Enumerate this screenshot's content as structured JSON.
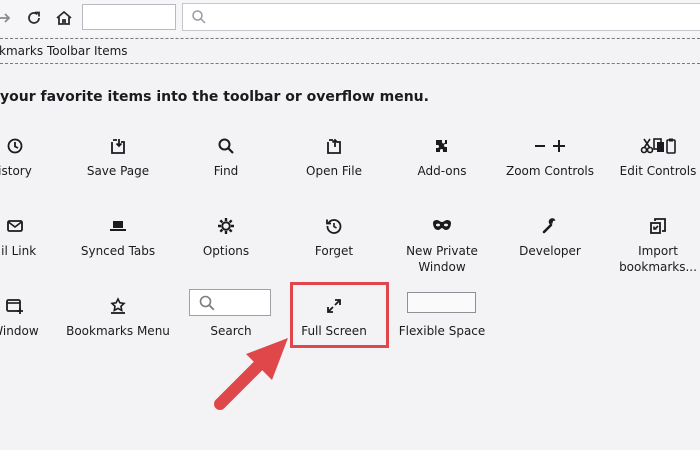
{
  "bookmarks_toolbar": {
    "label": "kmarks Toolbar Items"
  },
  "instruction": "your favorite items into the toolbar or overflow menu.",
  "rows": [
    [
      {
        "label": "istory",
        "icon": "history-icon"
      },
      {
        "label": "Save Page",
        "icon": "save-page-icon"
      },
      {
        "label": "Find",
        "icon": "search-icon"
      },
      {
        "label": "Open File",
        "icon": "open-file-icon"
      },
      {
        "label": "Add-ons",
        "icon": "puzzle-icon"
      },
      {
        "label": "Zoom Controls",
        "icon": "zoom-controls-icon"
      },
      {
        "label": "Edit Controls",
        "icon": "edit-controls-icon"
      }
    ],
    [
      {
        "label": "ail Link",
        "icon": "mail-icon"
      },
      {
        "label": "Synced Tabs",
        "icon": "synced-tabs-icon"
      },
      {
        "label": "Options",
        "icon": "gear-icon"
      },
      {
        "label": "Forget",
        "icon": "forget-icon"
      },
      {
        "label": "New Private Window",
        "icon": "private-mask-icon"
      },
      {
        "label": "Developer",
        "icon": "wrench-icon"
      },
      {
        "label": "Import bookmarks...",
        "icon": "import-icon"
      }
    ],
    [
      {
        "label": "Window",
        "icon": "new-window-icon"
      },
      {
        "label": "Bookmarks Menu",
        "icon": "bookmarks-menu-icon"
      },
      {
        "label": "Search",
        "icon": "search-icon"
      },
      {
        "label": "Full Screen",
        "icon": "fullscreen-icon"
      },
      {
        "label": "Flexible Space",
        "icon": "flexible-space"
      }
    ]
  ],
  "colors": {
    "highlight": "#e0474b",
    "arrow": "#e0474b",
    "background": "#f3f3f5"
  }
}
